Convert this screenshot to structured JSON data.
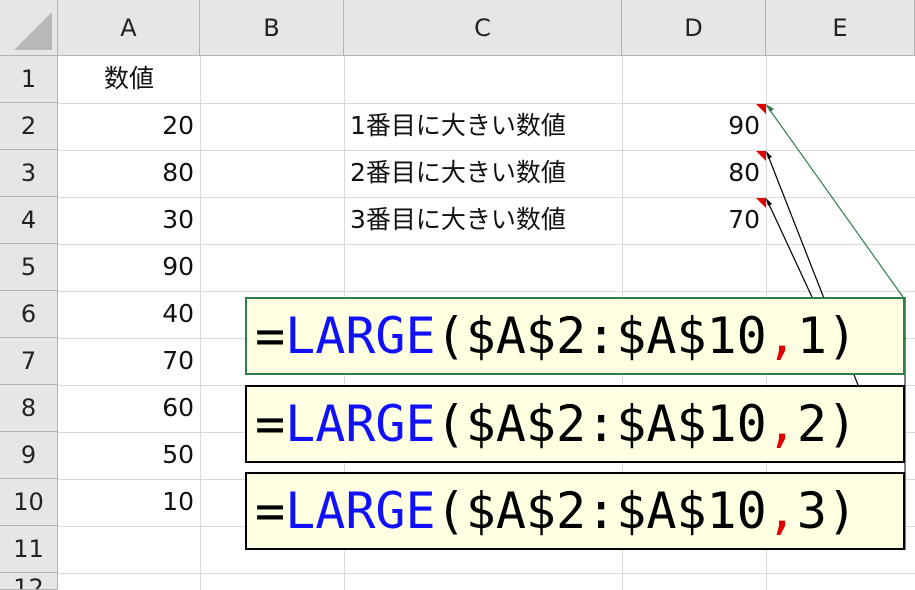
{
  "columns": [
    "A",
    "B",
    "C",
    "D",
    "E"
  ],
  "rows": [
    "1",
    "2",
    "3",
    "4",
    "5",
    "6",
    "7",
    "8",
    "9",
    "10",
    "11",
    "12"
  ],
  "cells": {
    "A1": "数値",
    "A2": "20",
    "A3": "80",
    "A4": "30",
    "A5": "90",
    "A6": "40",
    "A7": "70",
    "A8": "60",
    "A9": "50",
    "A10": "10",
    "C2": "1番目に大きい数値",
    "C3": "2番目に大きい数値",
    "C4": "3番目に大きい数値",
    "D2": "90",
    "D3": "80",
    "D4": "70"
  },
  "formulas": [
    {
      "prefix": "=",
      "fn": "LARGE",
      "args": "($A$2:$A$10",
      "comma": ",",
      "n": " 1)"
    },
    {
      "prefix": "=",
      "fn": "LARGE",
      "args": "($A$2:$A$10",
      "comma": ",",
      "n": " 2)"
    },
    {
      "prefix": "=",
      "fn": "LARGE",
      "args": "($A$2:$A$10",
      "comma": ",",
      "n": " 3)"
    }
  ],
  "colors": {
    "function": "#1010ff",
    "comma": "#e00000",
    "callout_fill": "#ffffe1",
    "callout_border_first": "#2e7d4f",
    "callout_border": "#000000",
    "comment_marker": "#e00000"
  }
}
